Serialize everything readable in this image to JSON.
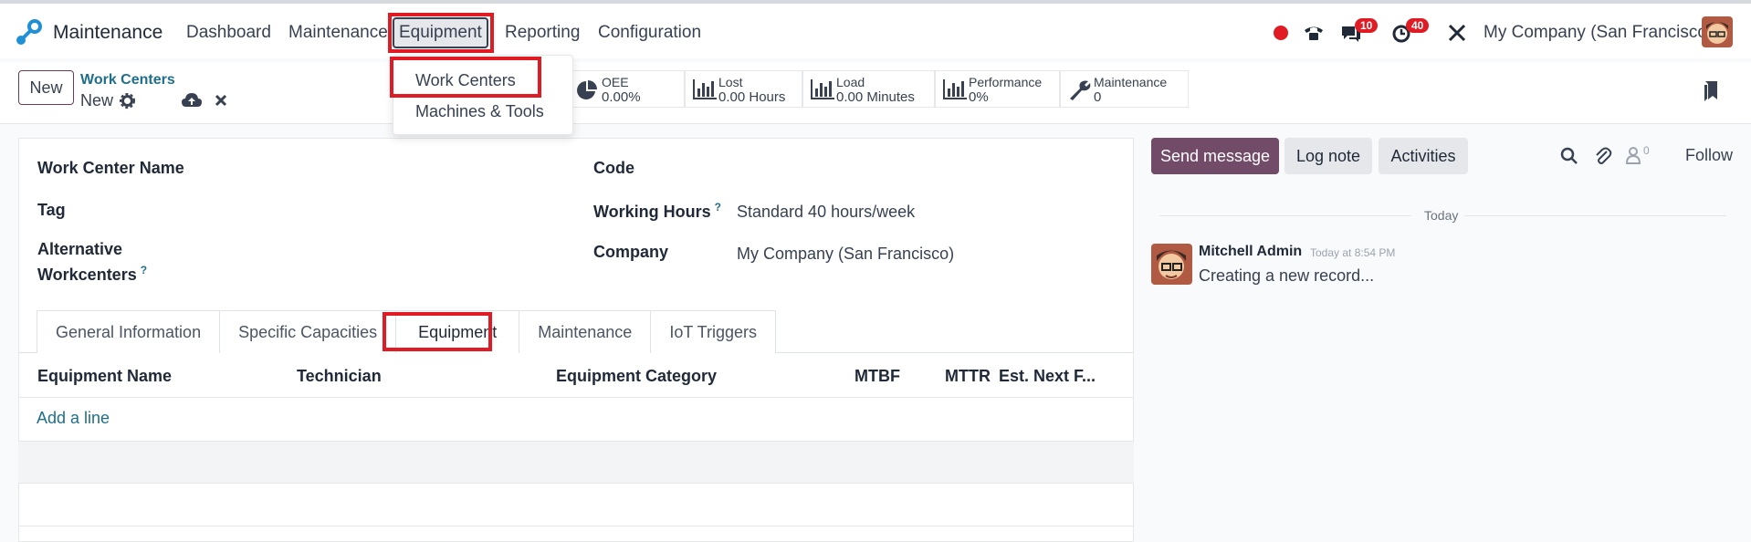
{
  "topbar": {
    "app_name": "Maintenance",
    "menu": [
      "Dashboard",
      "Maintenance",
      "Equipment",
      "Reporting",
      "Configuration"
    ],
    "active_menu": "Equipment",
    "messages_count": "10",
    "activities_count": "40",
    "company": "My Company (San Francisco)"
  },
  "dropdown": {
    "items": [
      "Work Centers",
      "Machines & Tools"
    ]
  },
  "control": {
    "new_label": "New",
    "breadcrumb": "Work Centers",
    "record_name": "New"
  },
  "stats": [
    {
      "label": "OEE",
      "value": "0.00%",
      "icon": "pie-chart-icon"
    },
    {
      "label": "Lost",
      "value": "0.00 Hours",
      "icon": "bar-chart-icon"
    },
    {
      "label": "Load",
      "value": "0.00 Minutes",
      "icon": "bar-chart-icon"
    },
    {
      "label": "Performance",
      "value": "0%",
      "icon": "bar-chart-icon"
    },
    {
      "label": "Maintenance",
      "value": "0",
      "icon": "wrench-icon"
    }
  ],
  "form": {
    "work_center_name_label": "Work Center Name",
    "tag_label": "Tag",
    "alt_label_line1": "Alternative",
    "alt_label_line2": "Workcenters",
    "code_label": "Code",
    "working_hours_label": "Working Hours",
    "working_hours_value": "Standard 40 hours/week",
    "company_label": "Company",
    "company_value": "My Company (San Francisco)",
    "help_mark": "?"
  },
  "tabs": [
    "General Information",
    "Specific Capacities",
    "Equipment",
    "Maintenance",
    "IoT Triggers"
  ],
  "active_tab": "Equipment",
  "table": {
    "columns": [
      "Equipment Name",
      "Technician",
      "Equipment Category",
      "MTBF",
      "MTTR",
      "Est. Next F..."
    ],
    "add_line": "Add a line"
  },
  "chatter": {
    "send_message": "Send message",
    "log_note": "Log note",
    "activities": "Activities",
    "followers_count": "0",
    "follow": "Follow",
    "date_separator": "Today",
    "message_author": "Mitchell Admin",
    "message_time": "Today at 8:54 PM",
    "message_body": "Creating a new record..."
  },
  "colors": {
    "brand": "#714b67",
    "highlight": "#e01b24",
    "link": "#1f6f8b"
  }
}
